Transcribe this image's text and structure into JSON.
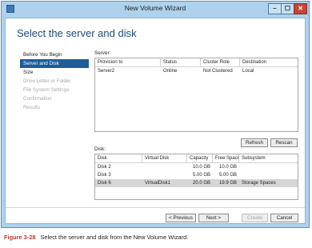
{
  "window": {
    "title": "New Volume Wizard",
    "controls": {
      "minimize": "–",
      "maximize": "☐",
      "close": "✕"
    }
  },
  "page": {
    "heading": "Select the server and disk"
  },
  "nav": {
    "items": [
      {
        "label": "Before You Begin",
        "state": "normal"
      },
      {
        "label": "Server and Disk",
        "state": "active"
      },
      {
        "label": "Size",
        "state": "normal"
      },
      {
        "label": "Drive Letter or Folder",
        "state": "disabled"
      },
      {
        "label": "File System Settings",
        "state": "disabled"
      },
      {
        "label": "Confirmation",
        "state": "disabled"
      },
      {
        "label": "Results",
        "state": "disabled"
      }
    ]
  },
  "server": {
    "label": "Server:",
    "columns": [
      "Provision to",
      "Status",
      "Cluster Role",
      "Destination"
    ],
    "rows": [
      [
        "Server2",
        "Online",
        "Not Clustered",
        "Local"
      ]
    ],
    "refresh_label": "Refresh",
    "rescan_label": "Rescan"
  },
  "disk": {
    "label": "Disk:",
    "columns": [
      "Disk",
      "Virtual Disk",
      "Capacity",
      "Free Space",
      "Subsystem"
    ],
    "rows": [
      [
        "Disk 2",
        "",
        "10.0 GB",
        "10.0 GB",
        ""
      ],
      [
        "Disk 3",
        "",
        "5.00 GB",
        "5.00 GB",
        ""
      ],
      [
        "Disk 6",
        "VirtualDisk1",
        "20.0 GB",
        "19.9 GB",
        "Storage Spaces"
      ]
    ],
    "selected_row": 2
  },
  "footer": {
    "previous_label": "< Previous",
    "next_label": "Next >",
    "create_label": "Create",
    "cancel_label": "Cancel"
  },
  "caption": {
    "figure": "Figure 3-28",
    "text": "Select the server and disk from the New Volume Wizard."
  }
}
